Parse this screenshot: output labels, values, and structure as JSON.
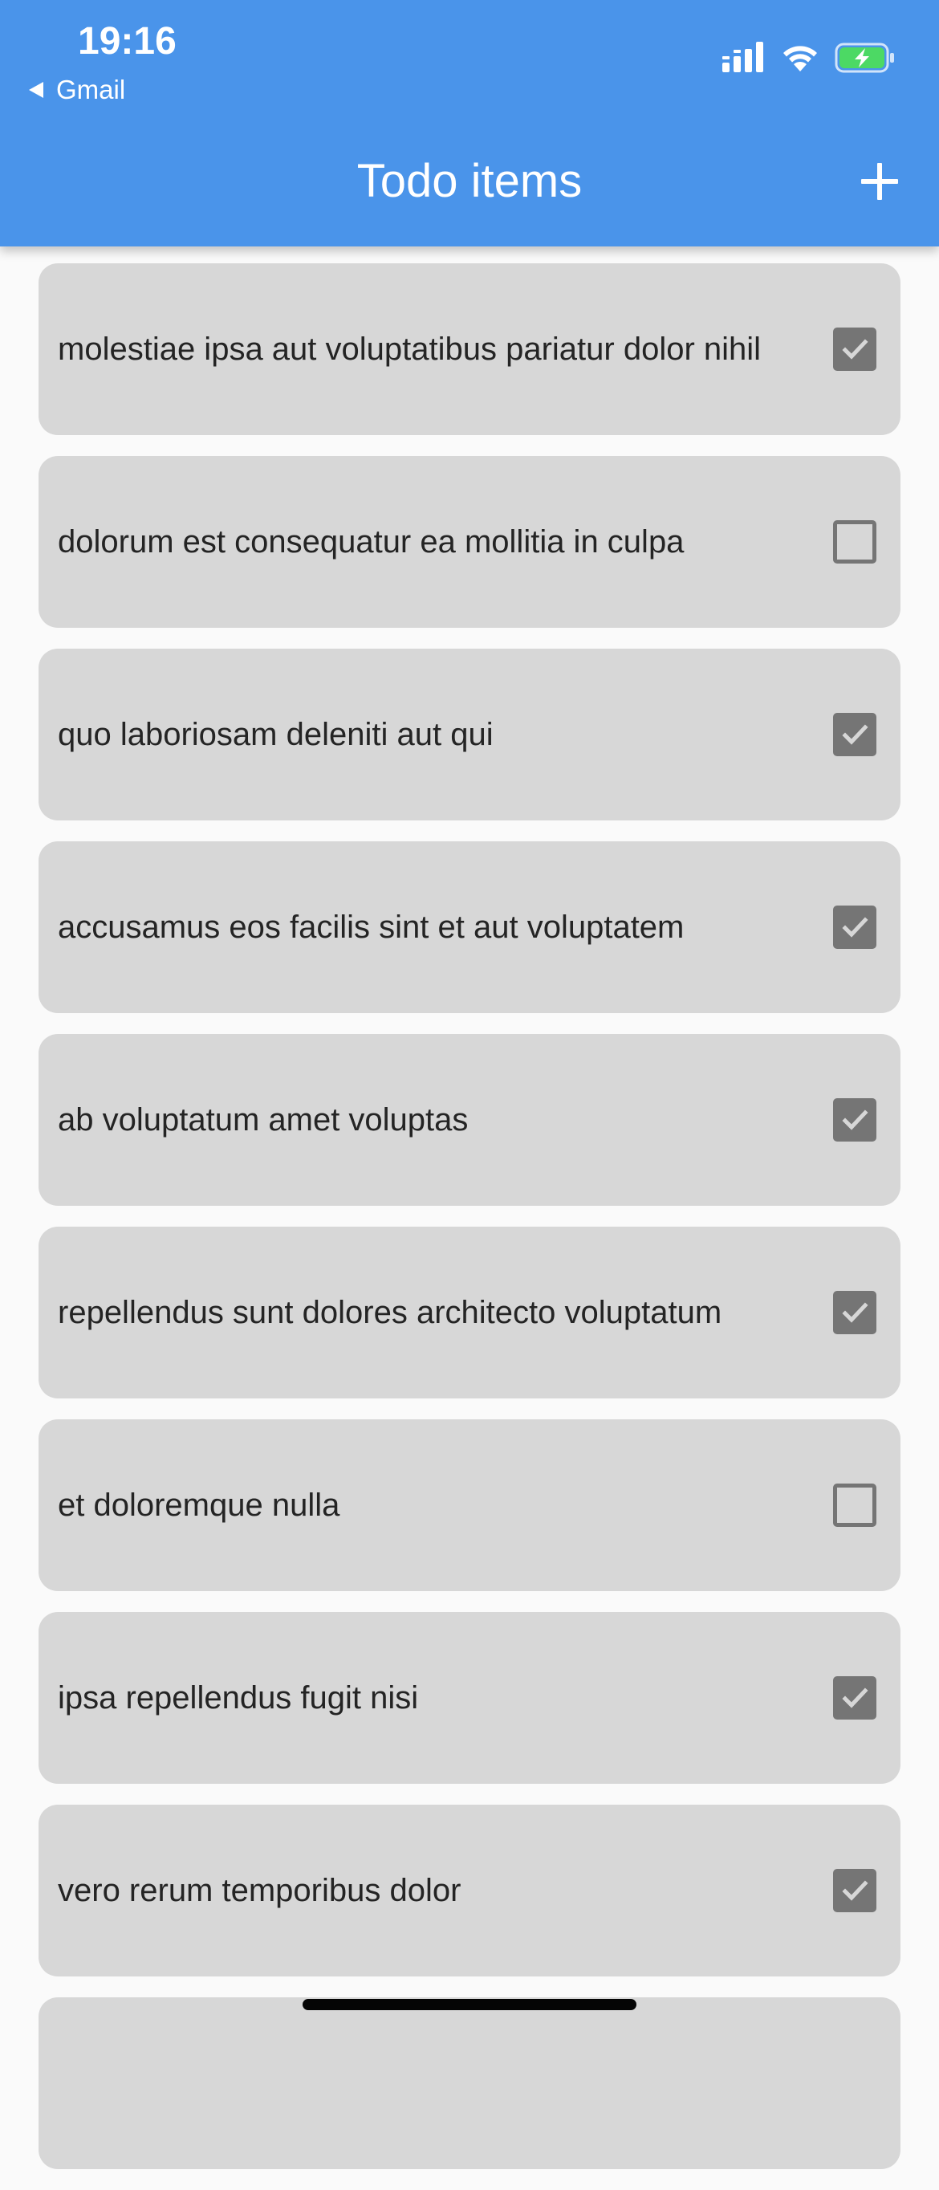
{
  "status_bar": {
    "time": "19:16",
    "back_app_label": "Gmail",
    "icons": [
      "cellular-signal-icon",
      "wifi-icon",
      "battery-charging-icon"
    ],
    "battery_color": "#4cd964"
  },
  "app_bar": {
    "title": "Todo items",
    "add_icon": "plus-icon",
    "background_color": "#4a94ea"
  },
  "todos": [
    {
      "title": "molestiae ipsa aut voluptatibus pariatur dolor nihil",
      "completed": true
    },
    {
      "title": "dolorum est consequatur ea mollitia in culpa",
      "completed": false
    },
    {
      "title": "quo laboriosam deleniti aut qui",
      "completed": true
    },
    {
      "title": "accusamus eos facilis sint et aut voluptatem",
      "completed": true
    },
    {
      "title": "ab voluptatum amet voluptas",
      "completed": true
    },
    {
      "title": "repellendus sunt dolores architecto voluptatum",
      "completed": true
    },
    {
      "title": "et doloremque nulla",
      "completed": false
    },
    {
      "title": "ipsa repellendus fugit nisi",
      "completed": true
    },
    {
      "title": "vero rerum temporibus dolor",
      "completed": true
    },
    {
      "title": "",
      "completed": false
    }
  ]
}
